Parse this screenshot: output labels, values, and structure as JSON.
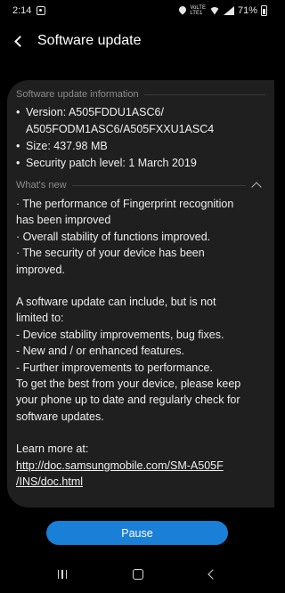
{
  "status": {
    "time": "2:14",
    "volte": "VoLTE",
    "lte": "LTE1",
    "battery": "71%"
  },
  "header": {
    "title": "Software update"
  },
  "info": {
    "section_title": "Software update information",
    "version_line1": "Version: A505FDDU1ASC6/",
    "version_line2": "A505FODM1ASC6/A505FXXU1ASC4",
    "size": "Size: 437.98 MB",
    "patch": "Security patch level: 1 March 2019"
  },
  "whats_new": {
    "title": "What's new",
    "lines": [
      "· The performance of Fingerprint recognition",
      "has been improved",
      "· Overall stability of functions improved.",
      "· The security of your device has been",
      "improved."
    ],
    "para_lines": [
      "A software update can include, but is not",
      "limited to:",
      " - Device stability improvements, bug fixes.",
      " - New and / or enhanced features.",
      " - Further improvements to performance.",
      "To get the best from your device, please keep",
      "your phone up to date and regularly check for",
      "software updates."
    ],
    "learn_more": "Learn more at:",
    "link_line1": "http://doc.samsungmobile.com/SM-A505F",
    "link_line2": "/INS/doc.html"
  },
  "actions": {
    "pause_label": "Pause"
  },
  "colors": {
    "accent": "#1a7fd6",
    "card": "#1f1f1f",
    "background": "#000000"
  },
  "icons": [
    "notification-icon",
    "location-icon",
    "wifi-icon",
    "signal-icon",
    "battery-icon",
    "back-icon",
    "collapse-icon",
    "recents-icon",
    "home-icon",
    "nav-back-icon"
  ]
}
